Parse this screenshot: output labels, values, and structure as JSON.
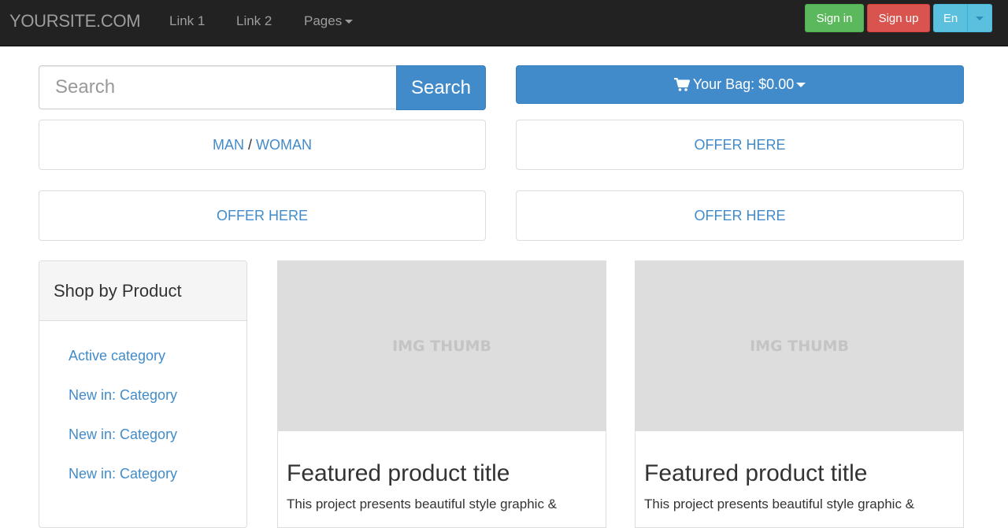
{
  "navbar": {
    "brand": "YOURSITE.COM",
    "links": [
      "Link 1",
      "Link 2"
    ],
    "pages_label": "Pages",
    "signin_label": "Sign in",
    "signup_label": "Sign up",
    "language_label": "En"
  },
  "search": {
    "placeholder": "Search",
    "button_label": "Search"
  },
  "bag": {
    "label": "Your Bag: $0.00"
  },
  "offers": {
    "man": "MAN",
    "woman": "WOMAN",
    "slash": "/",
    "offer_label": "OFFER HERE"
  },
  "sidebar": {
    "title": "Shop by Product",
    "items": [
      "Active category",
      "New in: Category",
      "New in: Category",
      "New in: Category"
    ]
  },
  "products": [
    {
      "thumb_label": "IMG THUMB",
      "title": "Featured product title",
      "description": "This project presents beautiful style graphic &"
    },
    {
      "thumb_label": "IMG THUMB",
      "title": "Featured product title",
      "description": "This project presents beautiful style graphic &"
    }
  ],
  "colors": {
    "navbar_bg": "#222222",
    "primary": "#428bca",
    "success": "#5cb85c",
    "danger": "#d9534f",
    "info": "#5bc0de"
  },
  "icons": {
    "cart": "shopping-cart-icon",
    "caret": "caret-down-icon"
  }
}
